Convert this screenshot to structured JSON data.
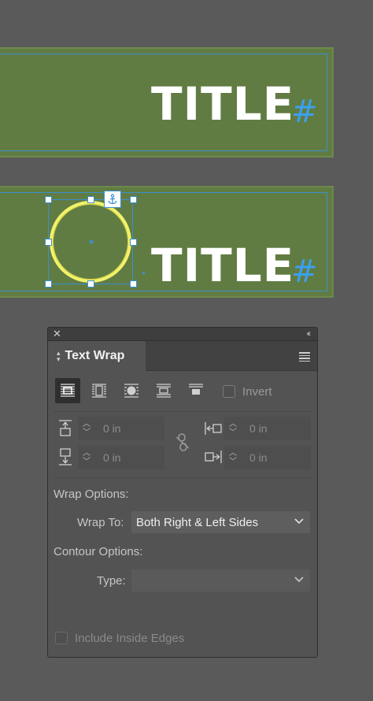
{
  "canvas": {
    "frame1": {
      "title": "TITLE",
      "hash": "#"
    },
    "frame2": {
      "title": "TITLE",
      "hash": "#"
    }
  },
  "panel": {
    "close_icon": "close-icon",
    "collapse_icon": "double-chevron-icon",
    "tab_label": "Text Wrap",
    "menu_icon": "panel-menu-icon",
    "wrap_modes": [
      {
        "icon": "no-text-wrap-icon",
        "active": true
      },
      {
        "icon": "wrap-around-bounding-box-icon",
        "active": false
      },
      {
        "icon": "wrap-around-object-shape-icon",
        "active": false
      },
      {
        "icon": "jump-object-icon",
        "active": false
      },
      {
        "icon": "jump-to-next-column-icon",
        "active": false
      }
    ],
    "invert_label": "Invert",
    "offsets": {
      "top": "0 in",
      "bottom": "0 in",
      "left": "0 in",
      "right": "0 in"
    },
    "wrap_options_label": "Wrap Options:",
    "wrap_to_label": "Wrap To:",
    "wrap_to_value": "Both Right & Left Sides",
    "contour_options_label": "Contour Options:",
    "type_label": "Type:",
    "type_value": "",
    "include_inside_edges_label": "Include Inside Edges"
  },
  "colors": {
    "background": "#5a5a5a",
    "frame_fill": "#617c43",
    "selection": "#3b8fd0",
    "circle_stroke": "#f2f26a",
    "hash": "#3aa0f0"
  }
}
